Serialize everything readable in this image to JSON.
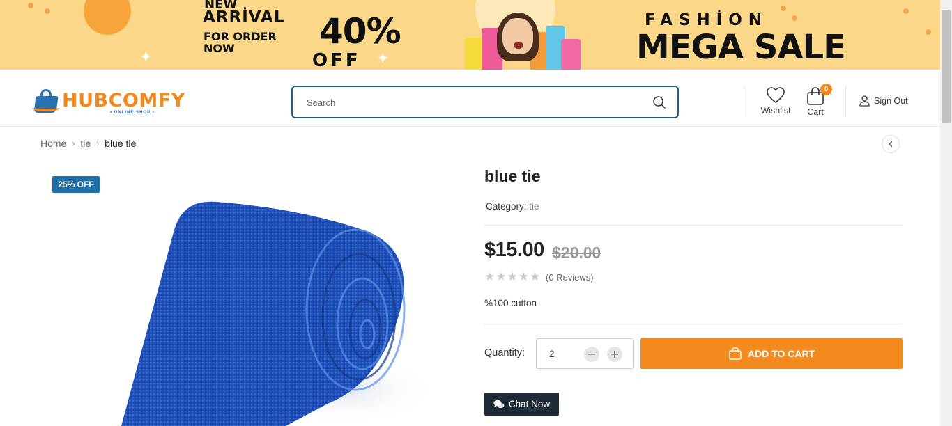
{
  "banner": {
    "new": "NEW",
    "arrival": "ARRİVAL",
    "for_order": "FOR ORDER",
    "now": "NOW",
    "discount": "40%",
    "off": "OFF",
    "fashion": "FASHİON",
    "mega_sale": "MEGA SALE"
  },
  "header": {
    "logo_text": "HUBCOMFY",
    "logo_sub": "• ONLINE SHOP •",
    "search_placeholder": "Search",
    "wishlist_label": "Wishlist",
    "cart_label": "Cart",
    "cart_count": "0",
    "signout_label": "Sign Out"
  },
  "breadcrumb": {
    "items": [
      "Home",
      "tie",
      "blue tie"
    ]
  },
  "product": {
    "discount_tag": "25% OFF",
    "title": "blue tie",
    "category_label": "Category:",
    "category_value": "tie",
    "price": "$15.00",
    "old_price": "$20.00",
    "rating": 0,
    "reviews": "(0 Reviews)",
    "description": "%100 cutton",
    "quantity_label": "Quantity:",
    "quantity_value": "2",
    "add_to_cart": "ADD TO CART",
    "chat_now": "Chat Now"
  },
  "colors": {
    "accent": "#f28a1d",
    "brand_blue": "#1f5f8b",
    "banner_bg": "#fbd78a",
    "dark_button": "#1e2a36"
  }
}
